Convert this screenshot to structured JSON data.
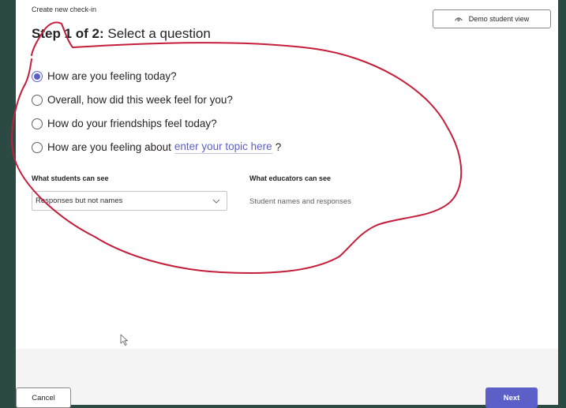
{
  "dialog": {
    "overline": "Create new check-in",
    "title_step": "Step 1 of 2:",
    "title_text": "Select a question"
  },
  "demo_button": {
    "label": "Demo student view",
    "icon": "eye-icon"
  },
  "questions": {
    "selected_index": 0,
    "items": [
      {
        "label": "How are you feeling today?"
      },
      {
        "label": "Overall, how did this week feel for you?"
      },
      {
        "label": "How do your friendships feel today?"
      },
      {
        "label_before": "How are you feeling about",
        "link_text": "enter your topic here",
        "label_after": "?"
      }
    ]
  },
  "visibility": {
    "students_label": "What students can see",
    "students_value": "Responses but not names",
    "educators_label": "What educators can see",
    "educators_value": "Student names and responses"
  },
  "footer": {
    "cancel_label": "Cancel",
    "next_label": "Next"
  },
  "colors": {
    "accent": "#5b5fc7",
    "annotation": "#c41e3a",
    "backdrop": "#2c4a44"
  }
}
